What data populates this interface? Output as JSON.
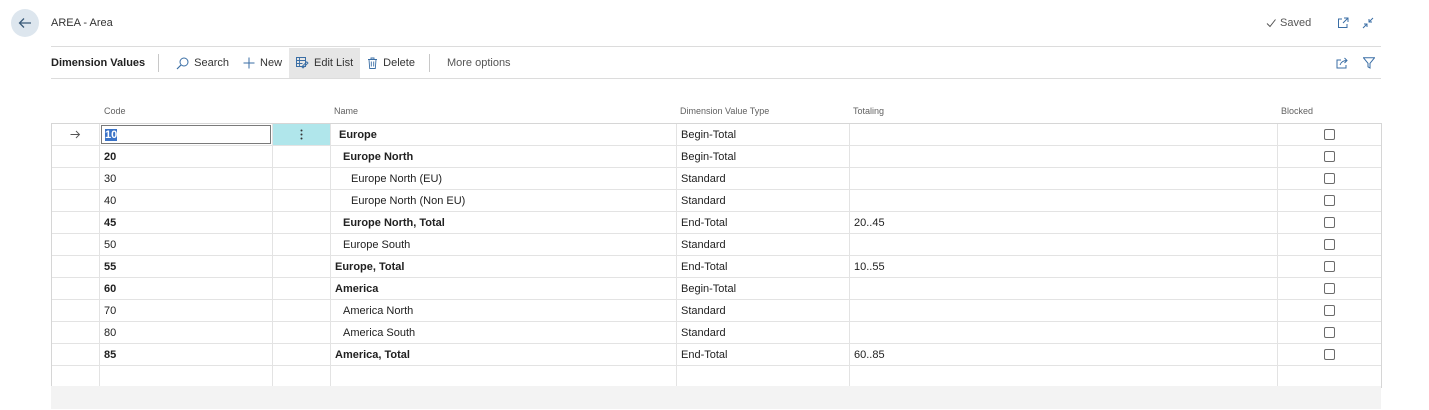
{
  "page": {
    "title": "AREA - Area",
    "saved_label": "Saved",
    "icons": {
      "back": "back-arrow-icon",
      "saved": "checkmark-icon",
      "open_new": "open-new-window-icon",
      "collapse": "collapse-icon"
    }
  },
  "actionbar": {
    "title": "Dimension Values",
    "search_label": "Search",
    "new_label": "New",
    "edit_list_label": "Edit List",
    "delete_label": "Delete",
    "more_label": "More options",
    "icons": {
      "search": "search-icon",
      "new": "plus-icon",
      "edit_list": "edit-list-icon",
      "delete": "trash-icon",
      "share": "share-icon",
      "filter": "filter-icon"
    }
  },
  "table": {
    "headers": {
      "code": "Code",
      "name": "Name",
      "type": "Dimension Value Type",
      "totaling": "Totaling",
      "blocked": "Blocked"
    },
    "rows": [
      {
        "code": "10",
        "name": "Europe",
        "type": "Begin-Total",
        "totaling": "",
        "blocked": false
      },
      {
        "code": "20",
        "name": "Europe North",
        "type": "Begin-Total",
        "totaling": "",
        "blocked": false
      },
      {
        "code": "30",
        "name": "Europe North (EU)",
        "type": "Standard",
        "totaling": "",
        "blocked": false
      },
      {
        "code": "40",
        "name": "Europe North (Non EU)",
        "type": "Standard",
        "totaling": "",
        "blocked": false
      },
      {
        "code": "45",
        "name": "Europe North, Total",
        "type": "End-Total",
        "totaling": "20..45",
        "blocked": false
      },
      {
        "code": "50",
        "name": "Europe South",
        "type": "Standard",
        "totaling": "",
        "blocked": false
      },
      {
        "code": "55",
        "name": "Europe, Total",
        "type": "End-Total",
        "totaling": "10..55",
        "blocked": false
      },
      {
        "code": "60",
        "name": "America",
        "type": "Begin-Total",
        "totaling": "",
        "blocked": false
      },
      {
        "code": "70",
        "name": "America North",
        "type": "Standard",
        "totaling": "",
        "blocked": false
      },
      {
        "code": "80",
        "name": "America South",
        "type": "Standard",
        "totaling": "",
        "blocked": false
      },
      {
        "code": "85",
        "name": "America, Total",
        "type": "End-Total",
        "totaling": "60..85",
        "blocked": false
      }
    ]
  }
}
